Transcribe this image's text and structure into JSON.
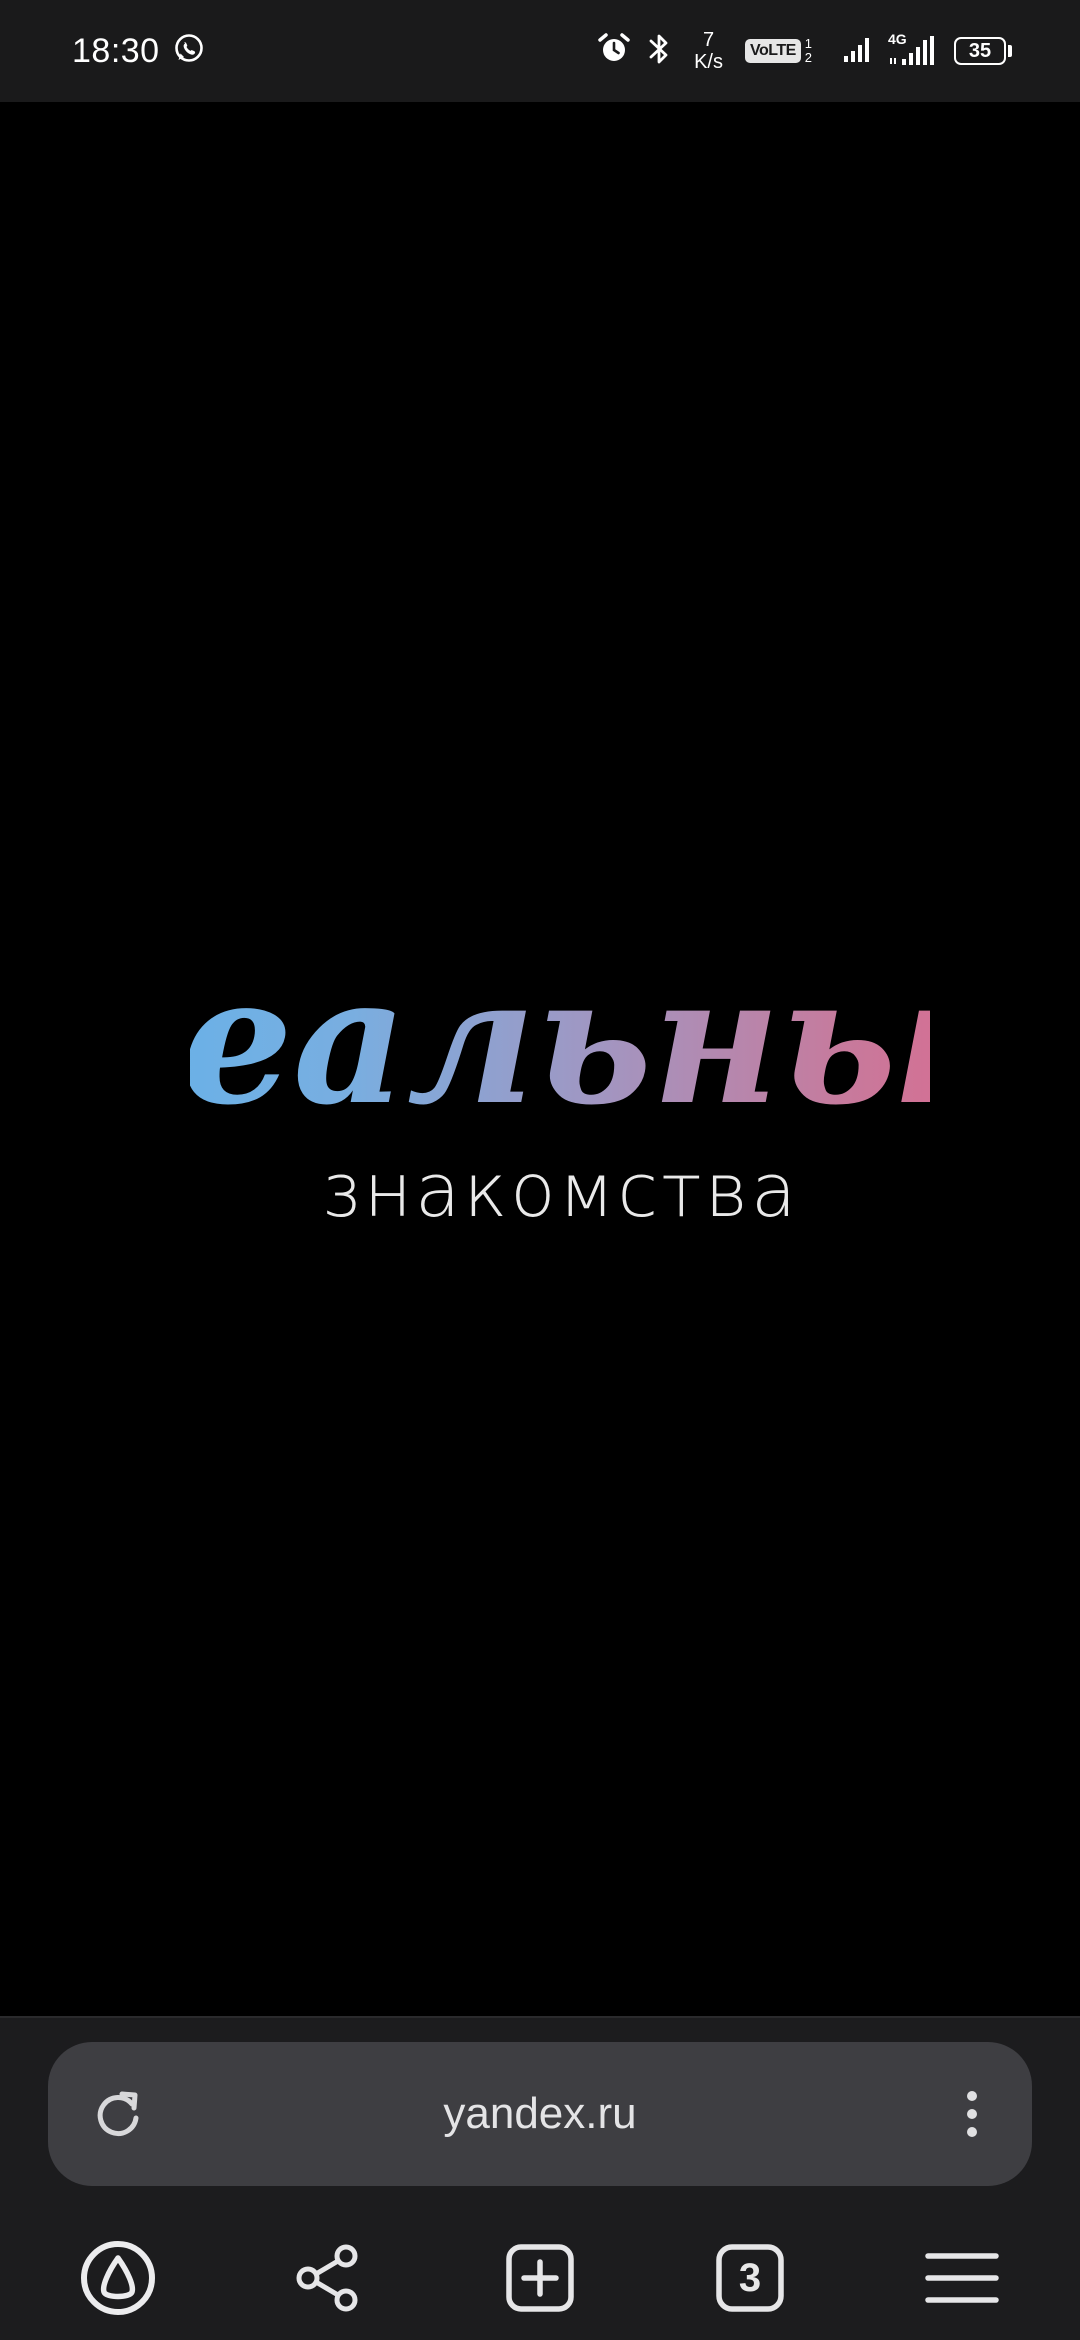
{
  "status_bar": {
    "time": "18:30",
    "network_speed_value": "7",
    "network_speed_unit": "K/s",
    "volte_label": "VoLTE",
    "volte_sim_top": "1",
    "volte_sim_bottom": "2",
    "mobile_type": "4G",
    "battery_level": "35",
    "icons": [
      "whatsapp-icon",
      "alarm-icon",
      "bluetooth-icon",
      "signal-icon",
      "signal-4g-icon",
      "battery-icon"
    ]
  },
  "logo": {
    "script_text": "Реальные",
    "subtitle": "знакомства",
    "gradient_colors": [
      "#5fb3ec",
      "#8aa6d8",
      "#a98fb8",
      "#d66a8e",
      "#e3648a"
    ]
  },
  "browser": {
    "url": "yandex.ru",
    "tabs_count": "3",
    "icons": [
      "reload-icon",
      "more-vert-icon",
      "alice-icon",
      "share-icon",
      "new-tab-icon",
      "tabs-icon",
      "menu-icon"
    ]
  }
}
